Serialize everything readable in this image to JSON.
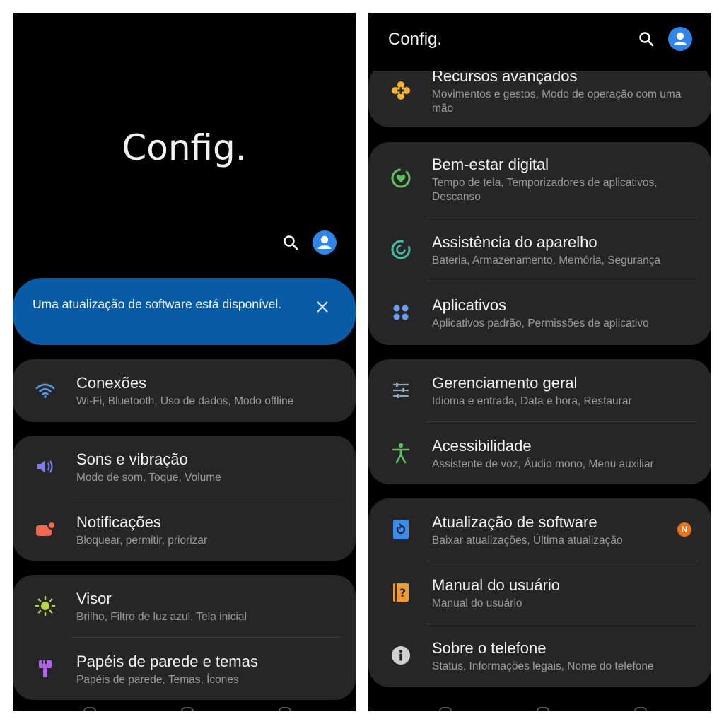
{
  "left": {
    "title": "Config.",
    "banner": "Uma atualização de software está disponível.",
    "groups": [
      [
        {
          "title": "Conexões",
          "sub": "Wi-Fi, Bluetooth, Uso de dados, Modo offline"
        }
      ],
      [
        {
          "title": "Sons e vibração",
          "sub": "Modo de som, Toque, Volume"
        },
        {
          "title": "Notificações",
          "sub": "Bloquear, permitir, priorizar"
        }
      ],
      [
        {
          "title": "Visor",
          "sub": "Brilho, Filtro de luz azul, Tela inicial"
        },
        {
          "title": "Papéis de parede e temas",
          "sub": "Papéis de parede, Temas, Ícones"
        }
      ]
    ]
  },
  "right": {
    "title": "Config.",
    "groups": [
      [
        {
          "title": "Recursos avançados",
          "sub": "Movimentos e gestos, Modo de operação com uma mão"
        }
      ],
      [
        {
          "title": "Bem-estar digital",
          "sub": "Tempo de tela, Temporizadores de aplicativos, Descanso"
        },
        {
          "title": "Assistência do aparelho",
          "sub": "Bateria, Armazenamento, Memória, Segurança"
        },
        {
          "title": "Aplicativos",
          "sub": "Aplicativos padrão, Permissões de aplicativo"
        }
      ],
      [
        {
          "title": "Gerenciamento geral",
          "sub": "Idioma e entrada, Data e hora, Restaurar"
        },
        {
          "title": "Acessibilidade",
          "sub": "Assistente de voz, Áudio mono, Menu auxiliar"
        }
      ],
      [
        {
          "title": "Atualização de software",
          "sub": "Baixar atualizações, Última atualização",
          "badge": "N"
        },
        {
          "title": "Manual do usuário",
          "sub": "Manual do usuário"
        },
        {
          "title": "Sobre o telefone",
          "sub": "Status, Informações legais, Nome do telefone"
        }
      ]
    ]
  },
  "colors": {
    "background": "#000000",
    "card": "#262626",
    "banner": "#0a5ba6",
    "accent": "#2f86e6",
    "badge": "#e8721c"
  },
  "icons": {
    "wifi": "wifi-icon",
    "sound": "volume-icon",
    "notifications": "notification-icon",
    "display": "brightness-icon",
    "wallpaper": "paintbrush-icon",
    "advanced": "plus-gear-icon",
    "wellbeing": "heart-ring-icon",
    "care": "device-care-icon",
    "apps": "apps-grid-icon",
    "general": "sliders-icon",
    "accessibility": "person-icon",
    "update": "update-icon",
    "manual": "help-book-icon",
    "about": "info-icon"
  }
}
